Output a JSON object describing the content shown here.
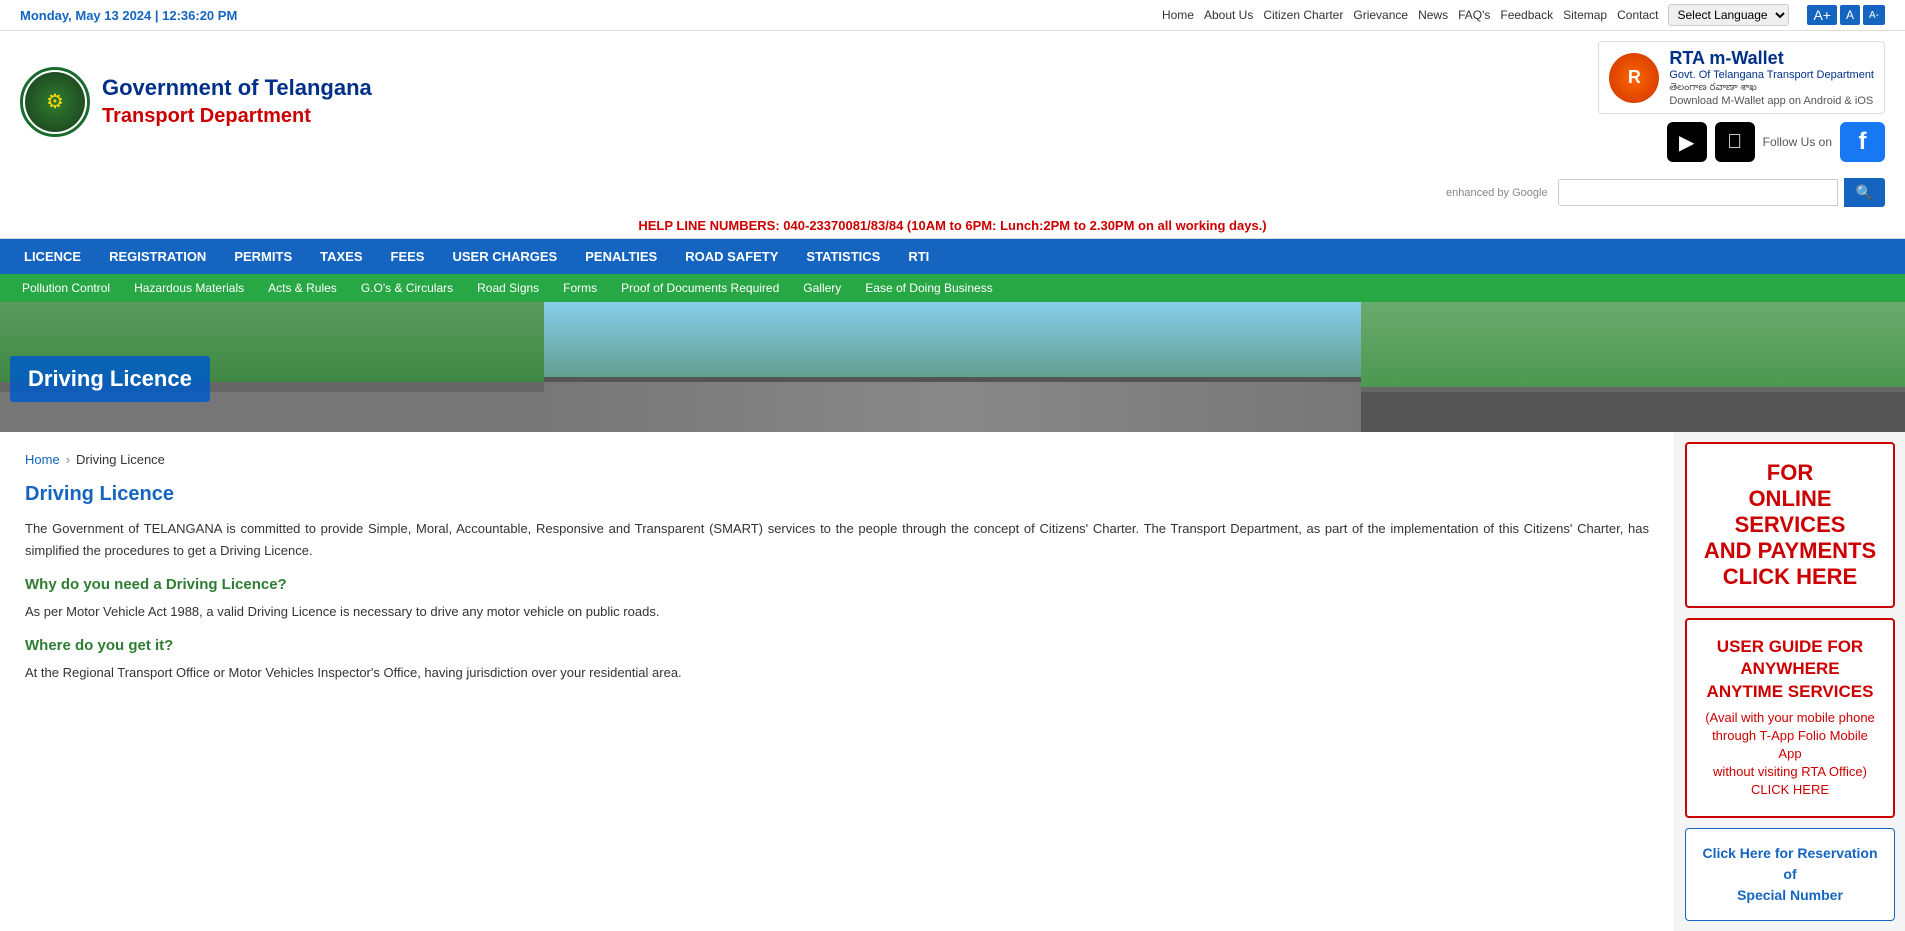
{
  "topbar": {
    "datetime": "Monday, May 13 2024 | 12:36:20 PM",
    "nav": [
      "Home",
      "About Us",
      "Citizen Charter",
      "Grievance",
      "News",
      "FAQ's",
      "Feedback",
      "Sitemap",
      "Contact"
    ],
    "language_placeholder": "Select Language",
    "font_a_plus": "A+",
    "font_a": "A",
    "font_a_minus": "A-"
  },
  "header": {
    "gov_name": "Government of Telangana",
    "dept_name": "Transport Department",
    "mwallet_title": "RTA m-Wallet",
    "mwallet_sub": "Govt. Of Telangana Transport Department",
    "mwallet_sub2": "తెలంగాణ రవాణా శాఖ",
    "mwallet_download": "Download M-Wallet app on Android & iOS",
    "follow_text": "Follow Us on"
  },
  "search": {
    "prefix": "enhanced by Google",
    "placeholder": "",
    "button_icon": "🔍"
  },
  "helpline": {
    "text": "HELP LINE NUMBERS: 040-23370081/83/84 (10AM to 6PM: Lunch:2PM to 2.30PM on all working days.)"
  },
  "main_nav": {
    "items": [
      "LICENCE",
      "REGISTRATION",
      "PERMITS",
      "TAXES",
      "FEES",
      "USER CHARGES",
      "PENALTIES",
      "ROAD SAFETY",
      "STATISTICS",
      "RTI"
    ]
  },
  "sub_nav": {
    "items": [
      "Pollution Control",
      "Hazardous Materials",
      "Acts & Rules",
      "G.O's & Circulars",
      "Road Signs",
      "Forms",
      "Proof of Documents Required",
      "Gallery",
      "Ease of Doing Business"
    ]
  },
  "hero": {
    "title": "Driving Licence"
  },
  "breadcrumb": {
    "home": "Home",
    "current": "Driving Licence"
  },
  "page": {
    "heading": "Driving Licence",
    "intro": "The Government of TELANGANA is committed to provide Simple, Moral, Accountable, Responsive and Transparent (SMART) services to the people through the concept of Citizens' Charter. The Transport Department, as part of the implementation of this Citizens' Charter, has simplified the procedures to get a Driving Licence.",
    "subheading1": "Why do you need a Driving Licence?",
    "para1": "As per Motor Vehicle Act 1988, a valid Driving Licence is necessary to drive any motor vehicle on public roads.",
    "subheading2": "Where do you get it?",
    "para2": "At the Regional Transport Office or Motor Vehicles Inspector's Office, having jurisdiction over your residential area."
  },
  "sidebar": {
    "online_services": {
      "line1": "FOR",
      "line2": "ONLINE SERVICES",
      "line3": "AND PAYMENTS",
      "line4": "CLICK HERE"
    },
    "user_guide": {
      "title": "USER GUIDE FOR\nANYWHERE\nANYTIME SERVICES",
      "sub": "(Avail with your mobile phone\nthrough T-App Folio Mobile App\nwithout visiting RTA Office)\nCLICK HERE"
    },
    "reservation": {
      "text": "Click Here for Reservation of\nSpecial Number"
    }
  }
}
